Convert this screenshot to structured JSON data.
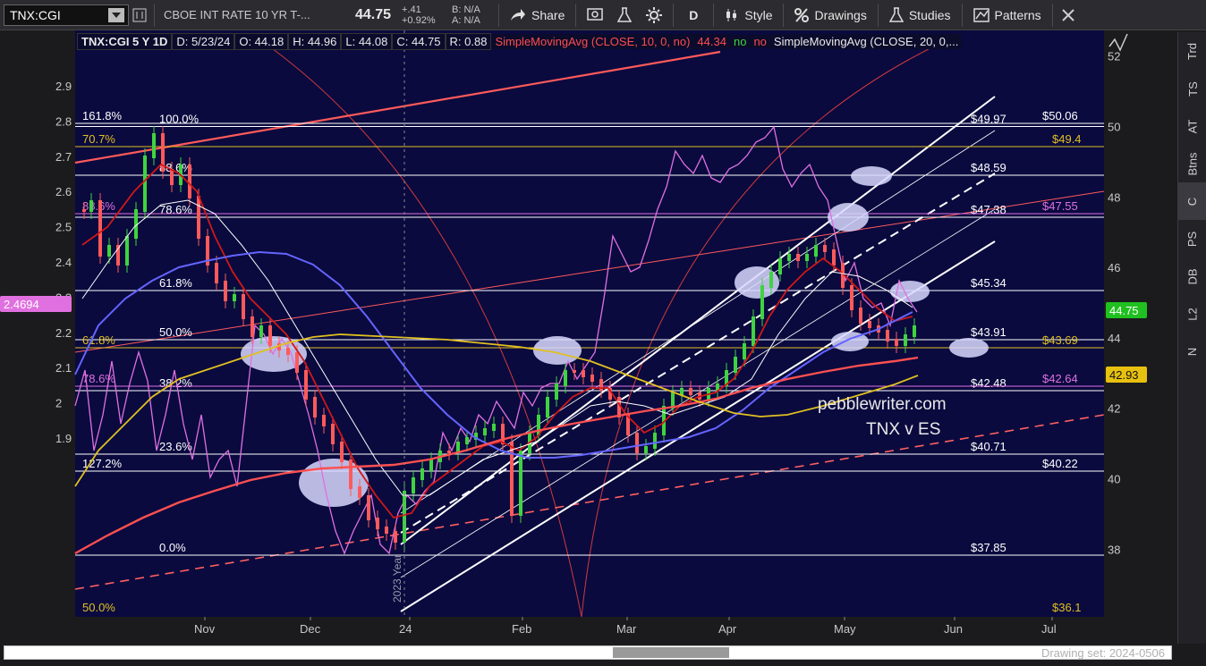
{
  "toolbar": {
    "symbol": "TNX:CGI",
    "description": "CBOE INT RATE 10 YR T-...",
    "last": "44.75",
    "change": "+.41",
    "change_pct": "+0.92%",
    "bid": "B: N/A",
    "ask": "A: N/A",
    "share": "Share",
    "aggregation": "D",
    "style": "Style",
    "drawings": "Drawings",
    "studies": "Studies",
    "patterns": "Patterns"
  },
  "header": {
    "info": "TNX:CGI 5 Y 1D",
    "date": "D: 5/23/24",
    "open": "O: 44.18",
    "high": "H: 44.96",
    "low": "L: 44.08",
    "close": "C: 44.75",
    "range": "R: 0.88",
    "sma10": "SimpleMovingAvg (CLOSE, 10, 0, no)",
    "sma10_value": "44.34",
    "flag_yes": "no",
    "flag_no": "no",
    "sma20": "SimpleMovingAvg (CLOSE, 20, 0,..."
  },
  "right_tabs": [
    "Trd",
    "TS",
    "AT",
    "Btns",
    "C",
    "PS",
    "DB",
    "L2",
    "N"
  ],
  "price_axis": [
    "52",
    "50",
    "48",
    "46",
    "44",
    "42",
    "40",
    "38"
  ],
  "left_axis": [
    "2.9",
    "2.8",
    "2.7",
    "2.6",
    "2.5",
    "2.4",
    "2.3",
    "2.2",
    "2.1",
    "2",
    "1.9"
  ],
  "time_axis": [
    "Nov",
    "Dec",
    "24",
    "Feb",
    "Mar",
    "Apr",
    "May",
    "Jun",
    "Jul"
  ],
  "badges": {
    "left_value": "2.4694",
    "price_value": "44.75",
    "sma_value": "42.93"
  },
  "fib_levels": [
    {
      "pct": "100.0%",
      "price": "$49.97"
    },
    {
      "pct": "88.6%",
      "price": "$48.59"
    },
    {
      "pct": "78.6%",
      "price": "$47.38"
    },
    {
      "pct": "61.8%",
      "price": "$45.34"
    },
    {
      "pct": "50.0%",
      "price": "$43.91"
    },
    {
      "pct": "38.2%",
      "price": "$42.48"
    },
    {
      "pct": "23.6%",
      "price": "$40.71"
    },
    {
      "pct": "0.0%",
      "price": "$37.85"
    }
  ],
  "ext_levels": [
    {
      "pct": "161.8%",
      "price": "$50.06"
    },
    {
      "pct": "70.7%",
      "price": "$49.4"
    },
    {
      "pct": "88.6%",
      "price": "$47.55"
    },
    {
      "pct": "61.8%",
      "price": "$43.69"
    },
    {
      "pct": "78.6%",
      "price": "$42.64"
    },
    {
      "pct": "127.2%",
      "price": "$40.22"
    },
    {
      "pct": "50.0%",
      "price": "$36.1"
    }
  ],
  "annotations": {
    "watermark": "pebblewriter.com",
    "subtitle": "TNX v ES",
    "year_marker": "2023 Year",
    "drawing_set": "Drawing set: 2024-0506"
  },
  "colors": {
    "background": "#0a0a3f",
    "up": "#3fd43f",
    "down": "#ff5a5a",
    "sma10": "#d01818",
    "sma50": "#6464ff",
    "sma200": "#ff5050",
    "gold": "#e0c020",
    "pink": "#e070e0"
  }
}
